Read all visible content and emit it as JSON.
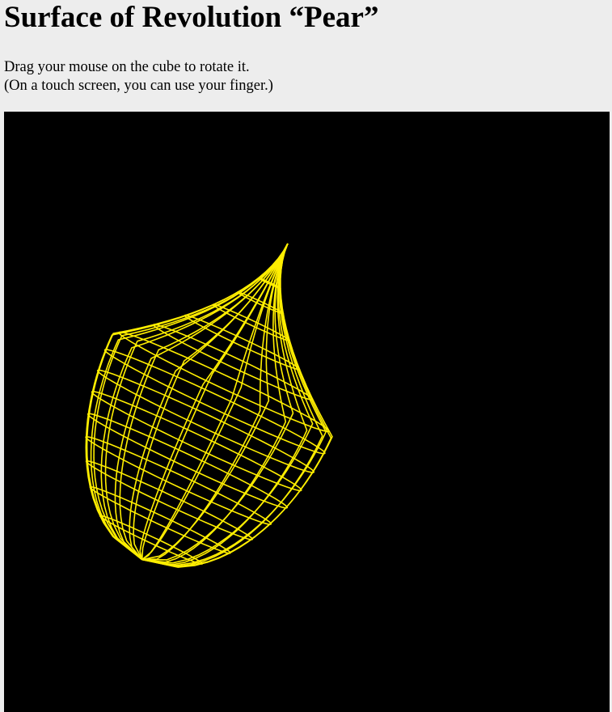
{
  "page": {
    "title": "Surface of Revolution “Pear”",
    "instruction_line1": "Drag your mouse on the cube to rotate it.",
    "instruction_line2": "(On a touch screen, you can use your finger.)"
  },
  "canvas": {
    "background_color": "#000000",
    "wire_color": "#ffee00",
    "shape_name": "pear-wireframe"
  }
}
